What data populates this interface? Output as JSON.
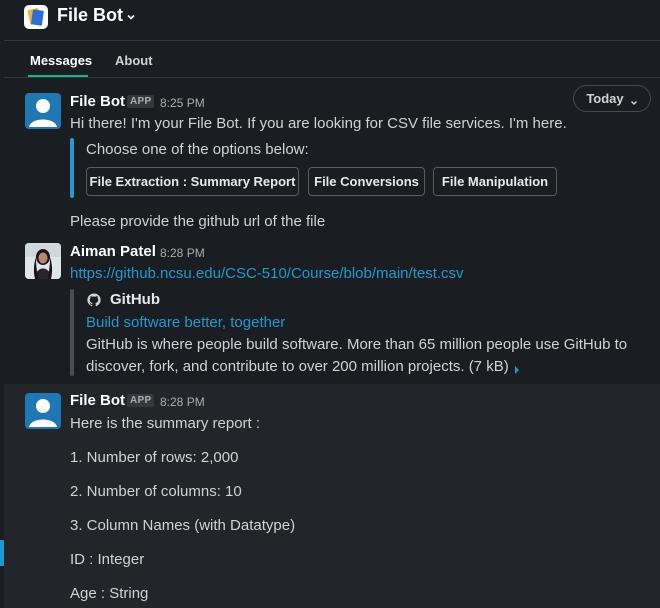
{
  "header": {
    "app_name": "File Bot"
  },
  "tabs": [
    {
      "label": "Messages",
      "active": true
    },
    {
      "label": "About",
      "active": false
    }
  ],
  "date_divider": {
    "label": "Today"
  },
  "messages": [
    {
      "sender": "File Bot",
      "badge": "APP",
      "time": "8:25 PM",
      "text": "Hi there! I'm your File Bot. If you are looking for CSV file services. I'm here.",
      "attachment": {
        "prompt": "Choose one of the options below:",
        "buttons": [
          "File Extraction : Summary Report",
          "File Conversions",
          "File Manipulation"
        ]
      },
      "followup": "Please provide the github url of the file"
    },
    {
      "sender": "Aiman Patel",
      "time": "8:28 PM",
      "link": "https://github.ncsu.edu/CSC-510/Course/blob/main/test.csv",
      "unfurl": {
        "site": "GitHub",
        "title": "Build software better, together",
        "description_line1": "GitHub is where people build software. More than 65 million people use GitHub to",
        "description_line2": "discover, fork, and contribute to over 200 million projects. (7 kB)"
      }
    },
    {
      "sender": "File Bot",
      "badge": "APP",
      "time": "8:28 PM",
      "lines": [
        "Here is the summary report :",
        "1. Number of rows: 2,000",
        "2. Number of columns: 10",
        "3. Column Names (with Datatype)",
        "ID : Integer",
        "Age : String"
      ]
    }
  ],
  "colors": {
    "background": "#1a1d21",
    "link": "#1d9bd1",
    "tab_underline": "#1bb38b",
    "attachment_bar": "#1d9bd1",
    "unfurl_bar": "#4a4d52"
  }
}
